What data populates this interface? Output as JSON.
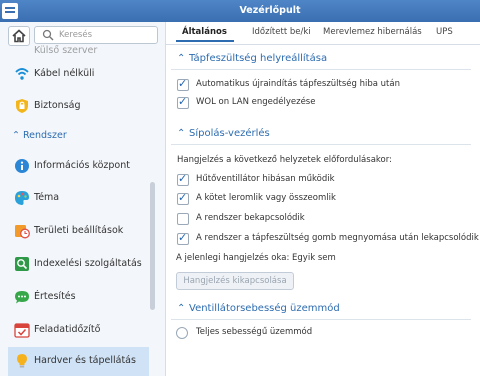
{
  "window": {
    "title": "Vezérlőpult"
  },
  "search": {
    "placeholder": "Keresés"
  },
  "sidebar": {
    "partial_item": "Külső szerver",
    "section_label": "Rendszer",
    "items": [
      {
        "label": "Kábel nélküli",
        "icon": "wifi-icon"
      },
      {
        "label": "Biztonság",
        "icon": "security-shield-icon"
      },
      {
        "label": "Információs központ",
        "icon": "info-icon"
      },
      {
        "label": "Téma",
        "icon": "palette-icon"
      },
      {
        "label": "Területi beállítások",
        "icon": "clock-icon"
      },
      {
        "label": "Indexelési szolgáltatás",
        "icon": "index-icon"
      },
      {
        "label": "Értesítés",
        "icon": "chat-bubble-icon"
      },
      {
        "label": "Feladatidőzítő",
        "icon": "calendar-icon"
      },
      {
        "label": "Hardver és tápellátás",
        "icon": "lightbulb-icon"
      }
    ]
  },
  "tabs": [
    "Általános",
    "Időzített be/ki",
    "Merevlemez hibernálás",
    "UPS"
  ],
  "sections": {
    "power_recovery": {
      "title": "Tápfeszültség helyreállítása",
      "options": [
        {
          "label": "Automatikus újraindítás tápfeszültség hiba után",
          "checked": true
        },
        {
          "label": "WOL on LAN engedélyezése",
          "checked": true
        }
      ]
    },
    "beep": {
      "title": "Sípolás-vezérlés",
      "intro": "Hangjelzés a következő helyzetek előfordulásakor:",
      "options": [
        {
          "label": "Hűtőventillátor hibásan működik",
          "checked": true
        },
        {
          "label": "A kötet leromlik vagy összeomlik",
          "checked": true
        },
        {
          "label": "A rendszer bekapcsolódik",
          "checked": false
        },
        {
          "label": "A rendszer a tápfeszültség gomb megnyomása után lekapcsolódik",
          "checked": true
        }
      ],
      "current_reason": "A jelenlegi hangjelzés oka: Egyik sem",
      "button": "Hangjelzés kikapcsolása"
    },
    "fan": {
      "title": "Ventillátorsebesség üzemmód",
      "option": "Teljes sebességű üzemmód"
    }
  },
  "colors": {
    "accent": "#2d6cb0",
    "titlebar": "#3f78bd",
    "active_item": "#cfe2f6"
  }
}
